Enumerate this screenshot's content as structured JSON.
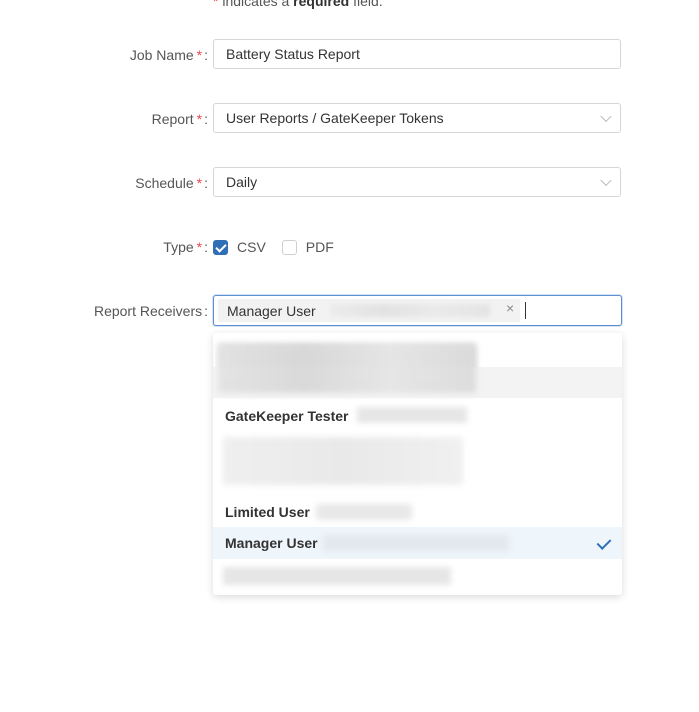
{
  "form": {
    "note_prefix": "* ",
    "note_mid": " indicates a ",
    "note_bold": "required",
    "note_suffix": " field.",
    "required_mark": "*",
    "colon": ":",
    "job_name": {
      "label": "Job Name",
      "value": "Battery Status Report"
    },
    "report": {
      "label": "Report",
      "value": "User Reports / GateKeeper Tokens"
    },
    "schedule": {
      "label": "Schedule",
      "value": "Daily"
    },
    "type": {
      "label": "Type",
      "options": [
        {
          "label": "CSV",
          "checked": true
        },
        {
          "label": "PDF",
          "checked": false
        }
      ]
    },
    "receivers": {
      "label": "Report Receivers",
      "selected_tag": "Manager User",
      "remove_glyph": "×"
    }
  },
  "dropdown": {
    "options": [
      {
        "label": "GateKeeper Tester"
      },
      {
        "label": "Limited User"
      },
      {
        "label": "Manager User",
        "selected": true
      }
    ]
  },
  "colors": {
    "accent": "#2f6fb5",
    "required": "#e5484d",
    "focus_border": "#5b8fd1",
    "selected_row": "#eef5fb"
  }
}
